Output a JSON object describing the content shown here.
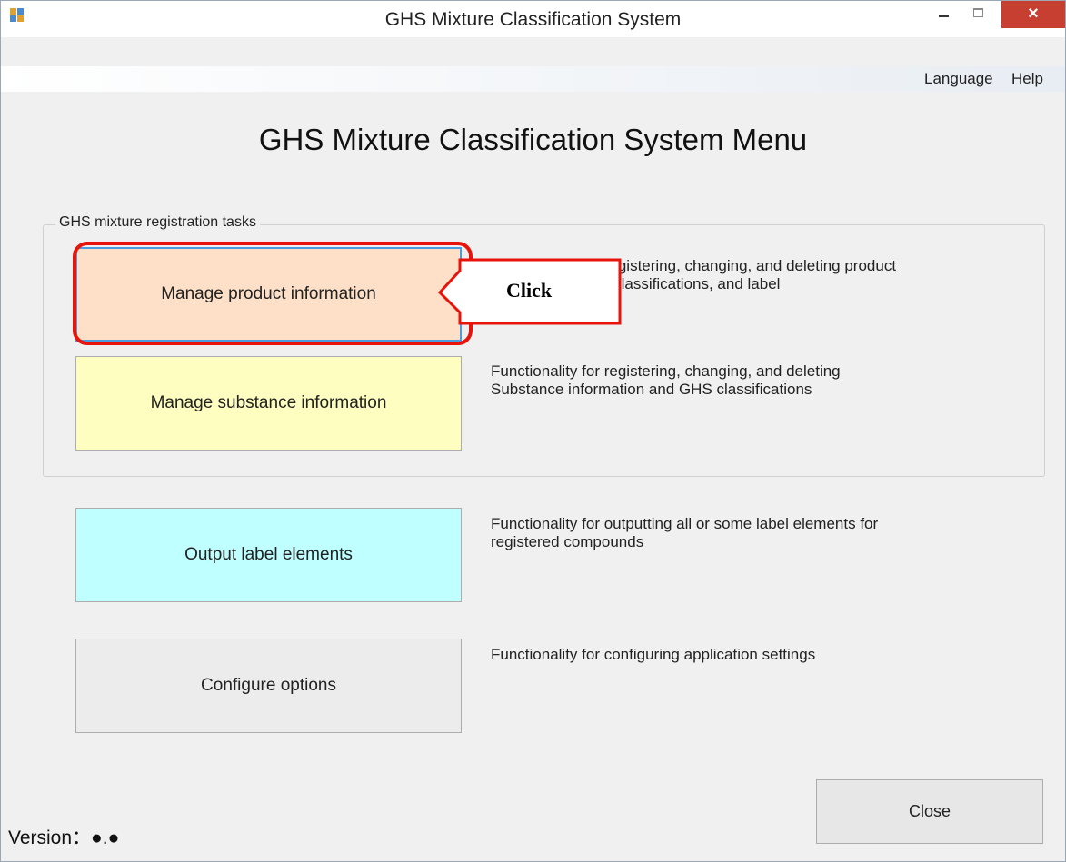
{
  "window": {
    "title": "GHS Mixture Classification System",
    "controls": {
      "minimize": "",
      "maximize": "",
      "close": "×"
    }
  },
  "menu": {
    "language": "Language",
    "help": "Help"
  },
  "heading": "GHS Mixture Classification System Menu",
  "group": {
    "title": "GHS mixture registration tasks",
    "buttons": [
      {
        "label": "Manage product information",
        "description": "Functionality for registering, changing, and deleting product information, GHS classifications, and label",
        "color": "#fde0c7"
      },
      {
        "label": "Manage substance information",
        "description": "Functionality for registering, changing, and deleting\nSubstance information and GHS classifications",
        "color": "#fefec0"
      }
    ]
  },
  "other_buttons": [
    {
      "label": "Output label elements",
      "description": "Functionality for outputting all or some label elements for\nregistered compounds",
      "color": "#bfffff"
    },
    {
      "label": "Configure options",
      "description": "Functionality for configuring application settings",
      "color": "#ececec"
    }
  ],
  "close_button": "Close",
  "version": "Version：●.●",
  "annotation": {
    "label": "Click",
    "color": "#e8140c"
  }
}
